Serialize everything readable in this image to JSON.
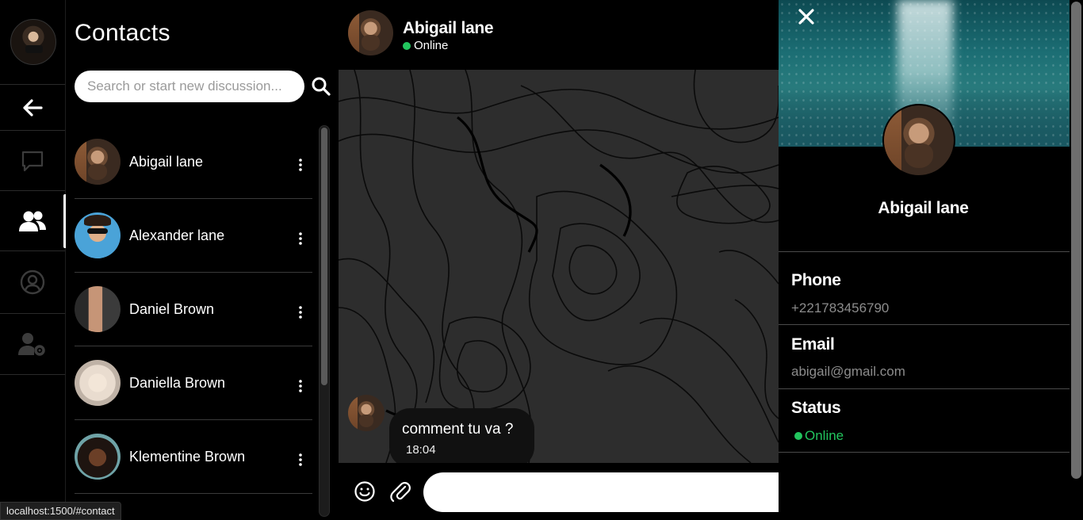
{
  "rail": {
    "nav": [
      {
        "name": "back",
        "icon": "arrow-left-icon"
      },
      {
        "name": "chats",
        "icon": "chat-bubble-icon"
      },
      {
        "name": "contacts",
        "icon": "users-icon",
        "active": true
      },
      {
        "name": "profile",
        "icon": "user-circle-icon"
      },
      {
        "name": "settings",
        "icon": "user-gear-icon"
      }
    ]
  },
  "contacts": {
    "title": "Contacts",
    "search_placeholder": "Search or start new discussion...",
    "items": [
      {
        "name": "Abigail lane"
      },
      {
        "name": "Alexander lane"
      },
      {
        "name": "Daniel Brown"
      },
      {
        "name": "Daniella Brown"
      },
      {
        "name": "Klementine Brown"
      }
    ]
  },
  "chat": {
    "contact_name": "Abigail lane",
    "contact_status": "Online",
    "messages": [
      {
        "text": "comment tu va ?",
        "time": "18:04"
      }
    ],
    "composer_emoji": "😀"
  },
  "profile": {
    "name": "Abigail lane",
    "phone_label": "Phone",
    "phone": "+221783456790",
    "email_label": "Email",
    "email": "abigail@gmail.com",
    "status_label": "Status",
    "status": "Online"
  },
  "browser": {
    "status_url": "localhost:1500/#contact"
  },
  "colors": {
    "background": "#000000",
    "online": "#22c55e",
    "chat_background": "#2d2d2d"
  }
}
